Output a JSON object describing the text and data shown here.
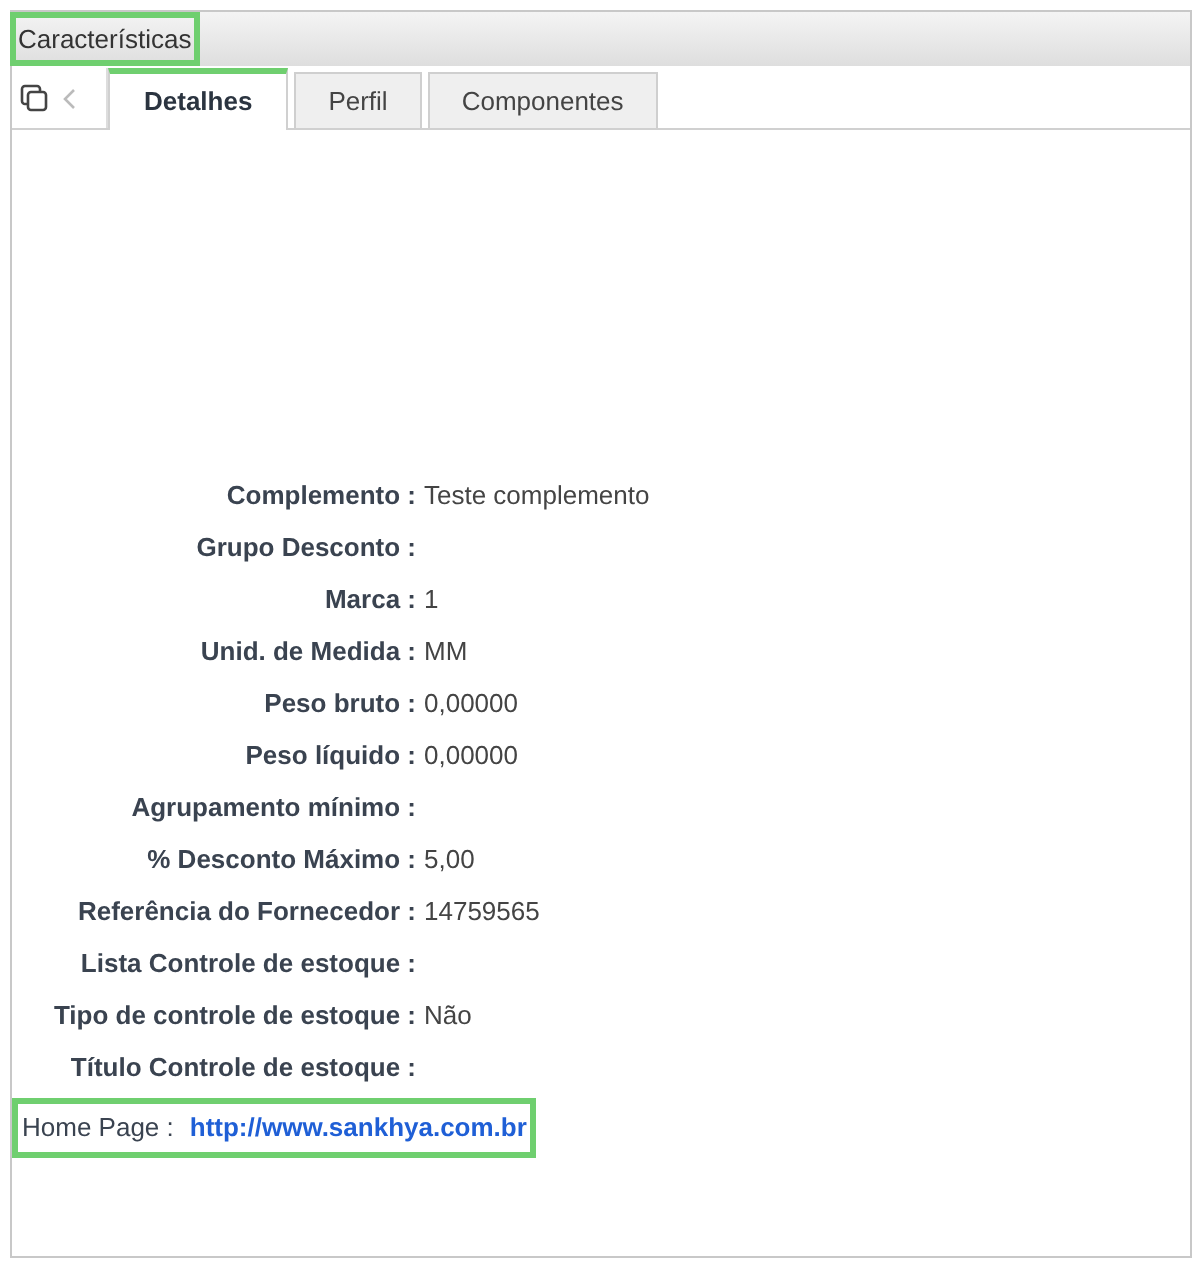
{
  "panel": {
    "title": "Características",
    "title_highlighted": true
  },
  "tabs": [
    {
      "label": "Detalhes",
      "selected": true
    },
    {
      "label": "Perfil",
      "selected": false
    },
    {
      "label": "Componentes",
      "selected": false
    }
  ],
  "fields": [
    {
      "kind": "field",
      "label": "Complemento :",
      "value": "Teste complemento"
    },
    {
      "kind": "field",
      "label": "Grupo Desconto :"
    },
    {
      "kind": "field",
      "label": "Marca :",
      "value": "1"
    },
    {
      "kind": "field",
      "label": "Unid. de Medida :",
      "value": "MM"
    },
    {
      "kind": "field",
      "label": "Peso bruto :",
      "value": "0,00000"
    },
    {
      "kind": "field",
      "label": "Peso líquido :",
      "value": "0,00000"
    },
    {
      "kind": "field",
      "label": "Agrupamento mínimo :"
    },
    {
      "kind": "field",
      "label": "% Desconto Máximo :",
      "value": "5,00"
    },
    {
      "kind": "field",
      "label": "Referência do Fornecedor :",
      "value": "14759565"
    },
    {
      "kind": "field",
      "label": "Lista Controle de estoque :"
    },
    {
      "kind": "field",
      "label": "Tipo de controle de estoque :",
      "value": "Não"
    },
    {
      "kind": "field",
      "label": "Título Controle de estoque :"
    },
    {
      "kind": "link",
      "label": "Home Page :",
      "value": "http://www.sankhya.com.br",
      "highlighted": true
    }
  ]
}
